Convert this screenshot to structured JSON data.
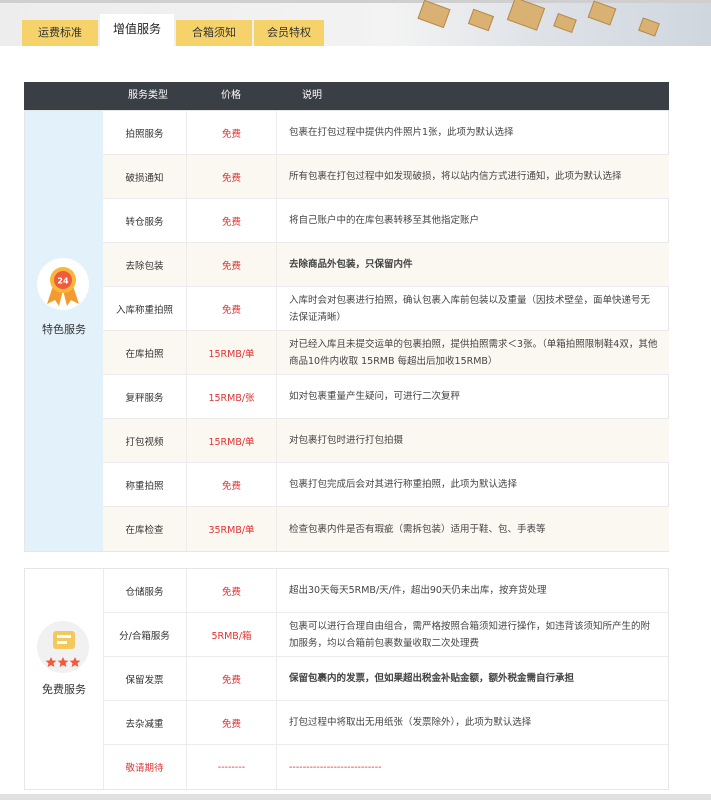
{
  "tabs": [
    "运费标准",
    "增值服务",
    "合箱须知",
    "会员特权"
  ],
  "active_tab": 1,
  "table_header": {
    "type": "服务类型",
    "price": "价格",
    "desc": "说明"
  },
  "section1": {
    "title": "特色服务",
    "badge_number": "24",
    "rows": [
      {
        "name": "拍照服务",
        "price": "免费",
        "desc": "包裹在打包过程中提供内件照片1张，此项为默认选择"
      },
      {
        "name": "破损通知",
        "price": "免费",
        "desc": "所有包裹在打包过程中如发现破损，将以站内信方式进行通知，此项为默认选择"
      },
      {
        "name": "转仓服务",
        "price": "免费",
        "desc": "将自己账户中的在库包裹转移至其他指定账户"
      },
      {
        "name": "去除包装",
        "price": "免费",
        "desc": "去除商品外包装，只保留内件"
      },
      {
        "name": "入库称重拍照",
        "price": "免费",
        "desc": "入库时会对包裹进行拍照，确认包裹入库前包装以及重量（因技术壁垒，面单快递号无法保证清晰）"
      },
      {
        "name": "在库拍照",
        "price": "15RMB/单",
        "desc": "对已经入库且未提交运单的包裹拍照，提供拍照需求＜3张。（单箱拍照限制鞋4双，其他商品10件内收取 15RMB 每超出后加收15RMB）"
      },
      {
        "name": "复秤服务",
        "price": "15RMB/张",
        "desc": "如对包裹重量产生疑问，可进行二次复秤"
      },
      {
        "name": "打包视频",
        "price": "15RMB/单",
        "desc": "对包裹打包时进行打包拍摄"
      },
      {
        "name": "称重拍照",
        "price": "免费",
        "desc": "包裹打包完成后会对其进行称重拍照，此项为默认选择"
      },
      {
        "name": "在库检查",
        "price": "35RMB/单",
        "desc": "检查包裹内件是否有瑕疵（需拆包装）适用于鞋、包、手表等"
      }
    ]
  },
  "section2": {
    "title": "免费服务",
    "rows": [
      {
        "name": "仓储服务",
        "price": "免费",
        "desc": "超出30天每天5RMB/天/件，超出90天仍未出库，按弃货处理"
      },
      {
        "name": "分/合箱服务",
        "price": "5RMB/箱",
        "desc": "包裹可以进行合理自由组合，需严格按照合箱须知进行操作，如违背该须知所产生的附加服务，均以合箱前包裹数量收取二次处理费"
      },
      {
        "name": "保留发票",
        "price": "免费",
        "desc": "保留包裹内的发票，但如果超出税金补贴金额，额外税金需自行承担"
      },
      {
        "name": "去杂减重",
        "price": "免费",
        "desc": "打包过程中将取出无用纸张（发票除外），此项为默认选择"
      },
      {
        "name": "敬请期待",
        "price": "--------",
        "desc": "---------------------------"
      }
    ]
  },
  "colors": {
    "tab_yellow": "#f5d36a",
    "header_dark": "#3a3f45",
    "price_red": "#dd3333",
    "feature_side": "#e3f1fb",
    "free_side": "#ffffff"
  }
}
